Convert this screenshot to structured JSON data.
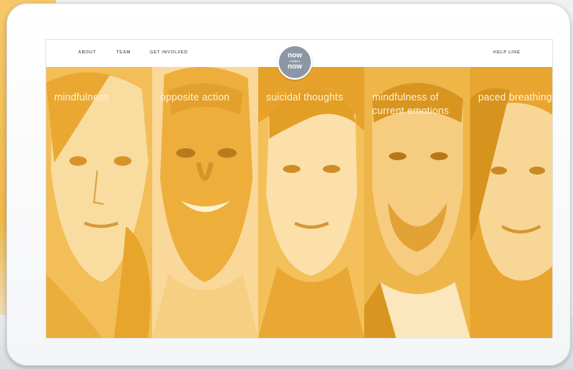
{
  "nav": {
    "links": [
      "ABOUT",
      "TEAM",
      "GET INVOLVED"
    ],
    "help": "HELP LINE"
  },
  "logo": {
    "line1": "now",
    "line2": "matters",
    "line3": "now"
  },
  "panels": [
    {
      "label": "mindfulness"
    },
    {
      "label": "opposite action"
    },
    {
      "label": "suicidal thoughts"
    },
    {
      "label": "mindfulness of current emotions"
    },
    {
      "label": "paced breathing"
    }
  ],
  "colors": {
    "panel_light": "#f8d38a",
    "panel_mid": "#f2bb4f",
    "panel_dark": "#e9a930",
    "label": "#fff3d6",
    "logo_bg": "#8b97a4"
  }
}
